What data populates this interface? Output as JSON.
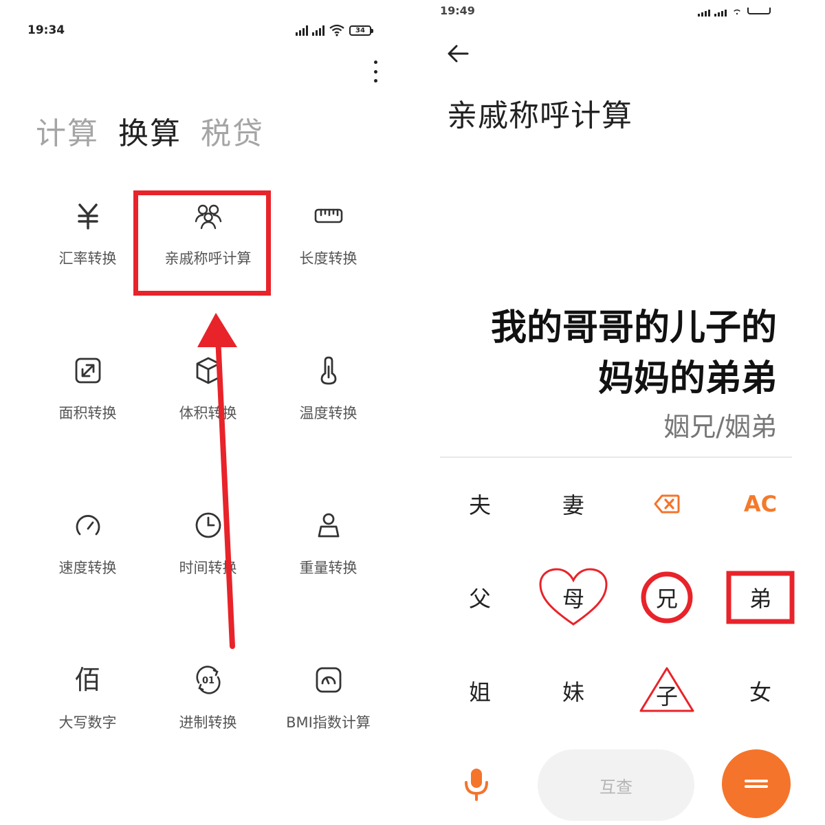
{
  "left": {
    "status_time": "19:34",
    "battery": "34",
    "tabs": [
      "计算",
      "换算",
      "税贷"
    ],
    "active_tab": 1,
    "tools": [
      {
        "label": "汇率转换",
        "icon": "yen-icon",
        "glyph": "¥"
      },
      {
        "label": "亲戚称呼计算",
        "icon": "relatives-icon"
      },
      {
        "label": "长度转换",
        "icon": "ruler-icon"
      },
      {
        "label": "面积转换",
        "icon": "area-icon"
      },
      {
        "label": "体积转换",
        "icon": "cube-icon"
      },
      {
        "label": "温度转换",
        "icon": "thermometer-icon"
      },
      {
        "label": "速度转换",
        "icon": "speedometer-icon"
      },
      {
        "label": "时间转换",
        "icon": "clock-icon"
      },
      {
        "label": "重量转换",
        "icon": "weight-icon"
      },
      {
        "label": "大写数字",
        "icon": "bai-icon",
        "glyph": "佰"
      },
      {
        "label": "进制转换",
        "icon": "binary-icon",
        "glyph": "01"
      },
      {
        "label": "BMI指数计算",
        "icon": "bmi-icon"
      }
    ]
  },
  "right": {
    "status_time": "19:49",
    "title": "亲戚称呼计算",
    "expression_line1": "我的哥哥的儿子的",
    "expression_line2": "妈妈的弟弟",
    "result": "姻兄/姻弟",
    "keys": [
      {
        "label": "夫"
      },
      {
        "label": "妻"
      },
      {
        "label": "",
        "icon": "backspace-icon"
      },
      {
        "label": "AC"
      },
      {
        "label": "父"
      },
      {
        "label": "母"
      },
      {
        "label": "兄"
      },
      {
        "label": "弟"
      },
      {
        "label": "姐"
      },
      {
        "label": "妹"
      },
      {
        "label": "子"
      },
      {
        "label": "女"
      }
    ],
    "query_label": "互查"
  },
  "colors": {
    "accent": "#f4742b",
    "annotation_red": "#e8232a"
  }
}
